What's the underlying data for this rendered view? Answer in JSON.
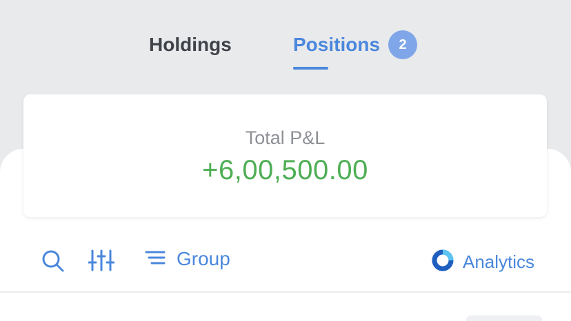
{
  "tabs": [
    {
      "label": "Holdings",
      "active": false
    },
    {
      "label": "Positions",
      "active": true,
      "badge": "2"
    }
  ],
  "pnl": {
    "label": "Total P&L",
    "value": "+6,00,500.00",
    "value_color": "#4eae54"
  },
  "toolbar": {
    "search_icon": "search-icon",
    "filter_icon": "sliders-icon",
    "group_label": "Group",
    "group_icon": "list-icon",
    "analytics_label": "Analytics",
    "analytics_icon": "ring-icon"
  },
  "colors": {
    "accent": "#4a87dd",
    "background": "#e9eaec",
    "badge": "#7fa6e8",
    "profit": "#4eae54"
  }
}
